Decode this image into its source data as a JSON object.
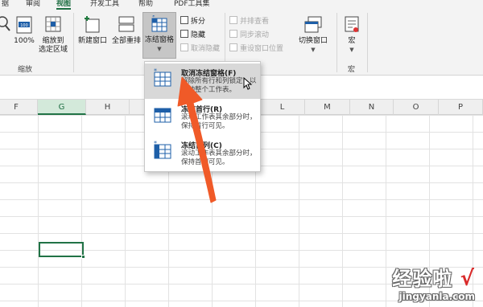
{
  "tabs": [
    "据",
    "审阅",
    "视图",
    "开发工具",
    "帮助",
    "PDF工具集"
  ],
  "active_tab": "视图",
  "ribbon": {
    "zoom_group": {
      "zoom_100": "100%",
      "zoom_to_selection_line1": "缩放到",
      "zoom_to_selection_line2": "选定区域",
      "label": "缩放"
    },
    "new_window": "新建窗口",
    "arrange_all": "全部重排",
    "freeze_panes": "冻结窗格",
    "split": "拆分",
    "hide": "隐藏",
    "unhide": "取消隐藏",
    "view_side_by_side": "并排查看",
    "sync_scroll": "同步滚动",
    "reset_window_position": "重设窗口位置",
    "switch_windows": "切换窗口",
    "macros": "宏",
    "macros_group_label": "宏"
  },
  "columns": [
    "F",
    "G",
    "H",
    "I",
    "J",
    "K",
    "L",
    "M",
    "N",
    "O",
    "P"
  ],
  "selected_column": "G",
  "freeze_menu": {
    "items": [
      {
        "title": "取消冻结窗格(F)",
        "desc": "解除所有行和列锁定，以滚动整个工作表。"
      },
      {
        "title": "冻结首行(R)",
        "desc": "滚动工作表其余部分时，保持首行可见。"
      },
      {
        "title": "冻结首列(C)",
        "desc": "滚动工作表其余部分时，保持首列可见。"
      }
    ]
  },
  "watermark": {
    "text": "经验啦",
    "check": "√",
    "url": "jingyanla.com"
  },
  "colors": {
    "accent": "#217346",
    "arrow": "#f05a28"
  }
}
